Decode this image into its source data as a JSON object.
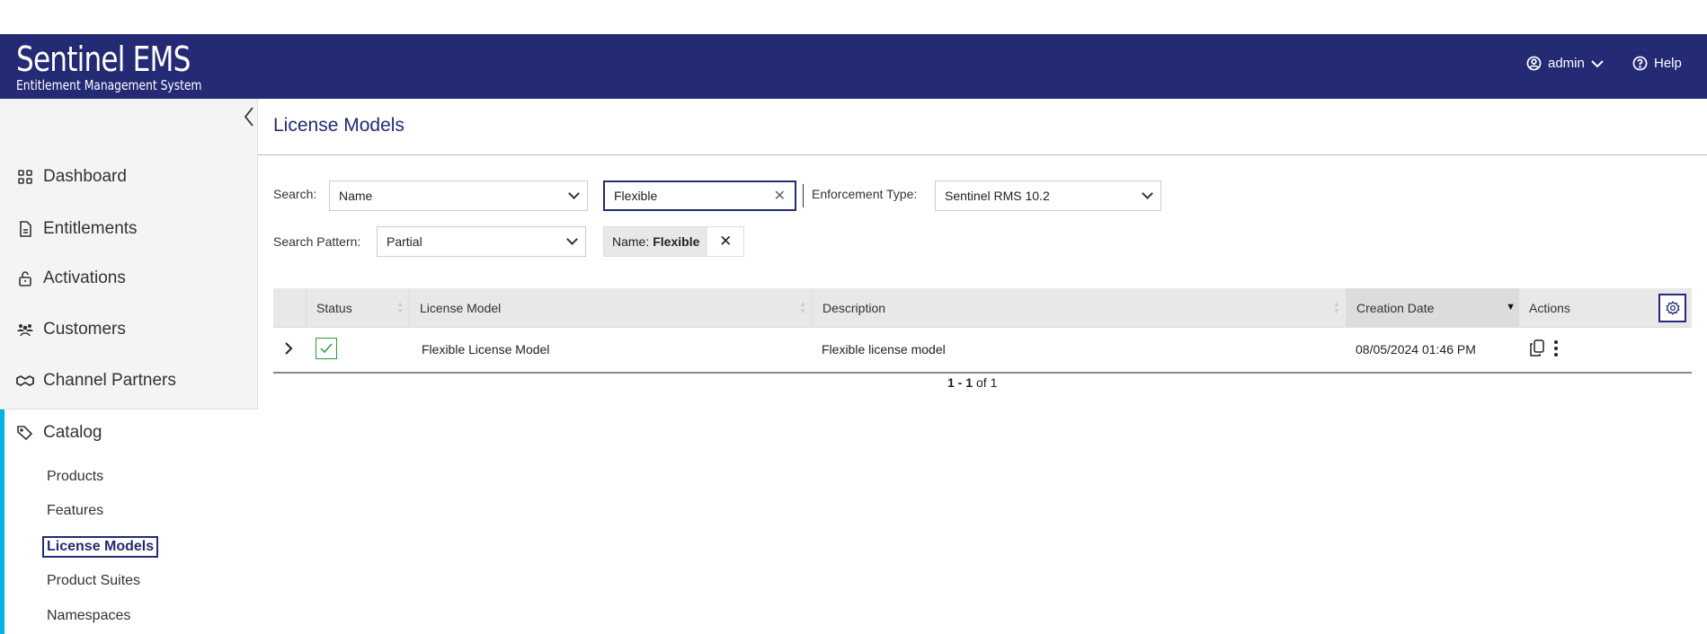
{
  "header": {
    "logo_title": "Sentinel EMS",
    "logo_subtitle": "Entitlement Management System",
    "user": "admin",
    "help": "Help"
  },
  "sidebar": {
    "items": [
      {
        "label": "Dashboard"
      },
      {
        "label": "Entitlements"
      },
      {
        "label": "Activations"
      },
      {
        "label": "Customers"
      },
      {
        "label": "Channel Partners"
      },
      {
        "label": "Catalog"
      }
    ],
    "catalog_sub": [
      {
        "label": "Products"
      },
      {
        "label": "Features"
      },
      {
        "label": "License Models"
      },
      {
        "label": "Product Suites"
      },
      {
        "label": "Namespaces"
      }
    ]
  },
  "page": {
    "title": "License Models"
  },
  "filters": {
    "search_label": "Search:",
    "search_field": "Name",
    "search_value": "Flexible",
    "enforcement_label": "Enforcement Type:",
    "enforcement_value": "Sentinel RMS 10.2",
    "pattern_label": "Search Pattern:",
    "pattern_value": "Partial",
    "chip_key": "Name:",
    "chip_value": "Flexible"
  },
  "table": {
    "columns": [
      "Status",
      "License Model",
      "Description",
      "Creation Date",
      "Actions"
    ],
    "rows": [
      {
        "license_model": "Flexible License Model",
        "description": "Flexible license model",
        "creation_date": "08/05/2024 01:46 PM",
        "status": "enabled"
      }
    ],
    "pagination": {
      "range": "1 - 1",
      "of": "of 1"
    }
  }
}
